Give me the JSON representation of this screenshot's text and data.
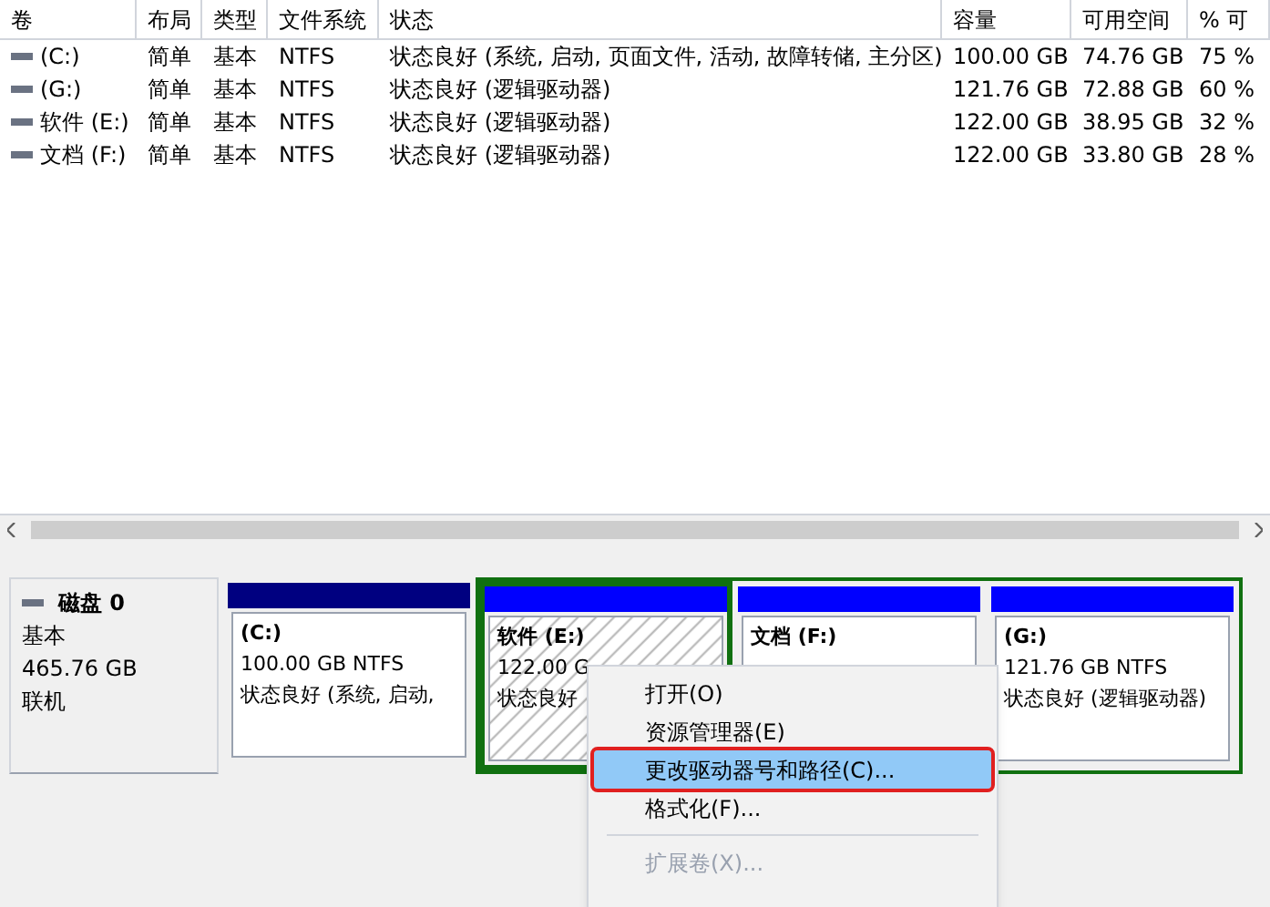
{
  "table": {
    "columns": [
      "卷",
      "布局",
      "类型",
      "文件系统",
      "状态",
      "容量",
      "可用空间",
      "% 可"
    ],
    "rows": [
      {
        "cells": [
          "(C:)",
          "简单",
          "基本",
          "NTFS",
          "状态良好 (系统, 启动, 页面文件, 活动, 故障转储, 主分区)",
          "100.00 GB",
          "74.76 GB",
          "75 %"
        ]
      },
      {
        "cells": [
          "(G:)",
          "简单",
          "基本",
          "NTFS",
          "状态良好 (逻辑驱动器)",
          "121.76 GB",
          "72.88 GB",
          "60 %"
        ]
      },
      {
        "cells": [
          "软件 (E:)",
          "简单",
          "基本",
          "NTFS",
          "状态良好 (逻辑驱动器)",
          "122.00 GB",
          "38.95 GB",
          "32 %"
        ]
      },
      {
        "cells": [
          "文档 (F:)",
          "简单",
          "基本",
          "NTFS",
          "状态良好 (逻辑驱动器)",
          "122.00 GB",
          "33.80 GB",
          "28 %"
        ]
      }
    ]
  },
  "disk": {
    "name": "磁盘 0",
    "type": "基本",
    "size": "465.76 GB",
    "state": "联机",
    "partitions": [
      {
        "kind": "primary",
        "label": "(C:)",
        "size": "100.00 GB NTFS",
        "status": "状态良好 (系统, 启动,",
        "selected": false
      },
      {
        "kind": "logical",
        "label": "软件 (E:)",
        "size": "122.00 G",
        "status": "状态良好",
        "selected": true
      },
      {
        "kind": "logical",
        "label": "文档 (F:)",
        "selected": false
      },
      {
        "kind": "logical",
        "label": "(G:)",
        "size": "121.76 GB NTFS",
        "status": "状态良好 (逻辑驱动器)",
        "selected": false
      }
    ]
  },
  "context_menu": [
    {
      "label": "打开(O)",
      "selected": false,
      "disabled": false
    },
    {
      "label": "资源管理器(E)",
      "selected": false,
      "disabled": false
    },
    {
      "label": "更改驱动器号和路径(C)...",
      "selected": true,
      "disabled": false
    },
    {
      "label": "格式化(F)...",
      "selected": false,
      "disabled": false,
      "separator_after": true
    },
    {
      "label": "扩展卷(X)...",
      "selected": false,
      "disabled": true
    }
  ]
}
